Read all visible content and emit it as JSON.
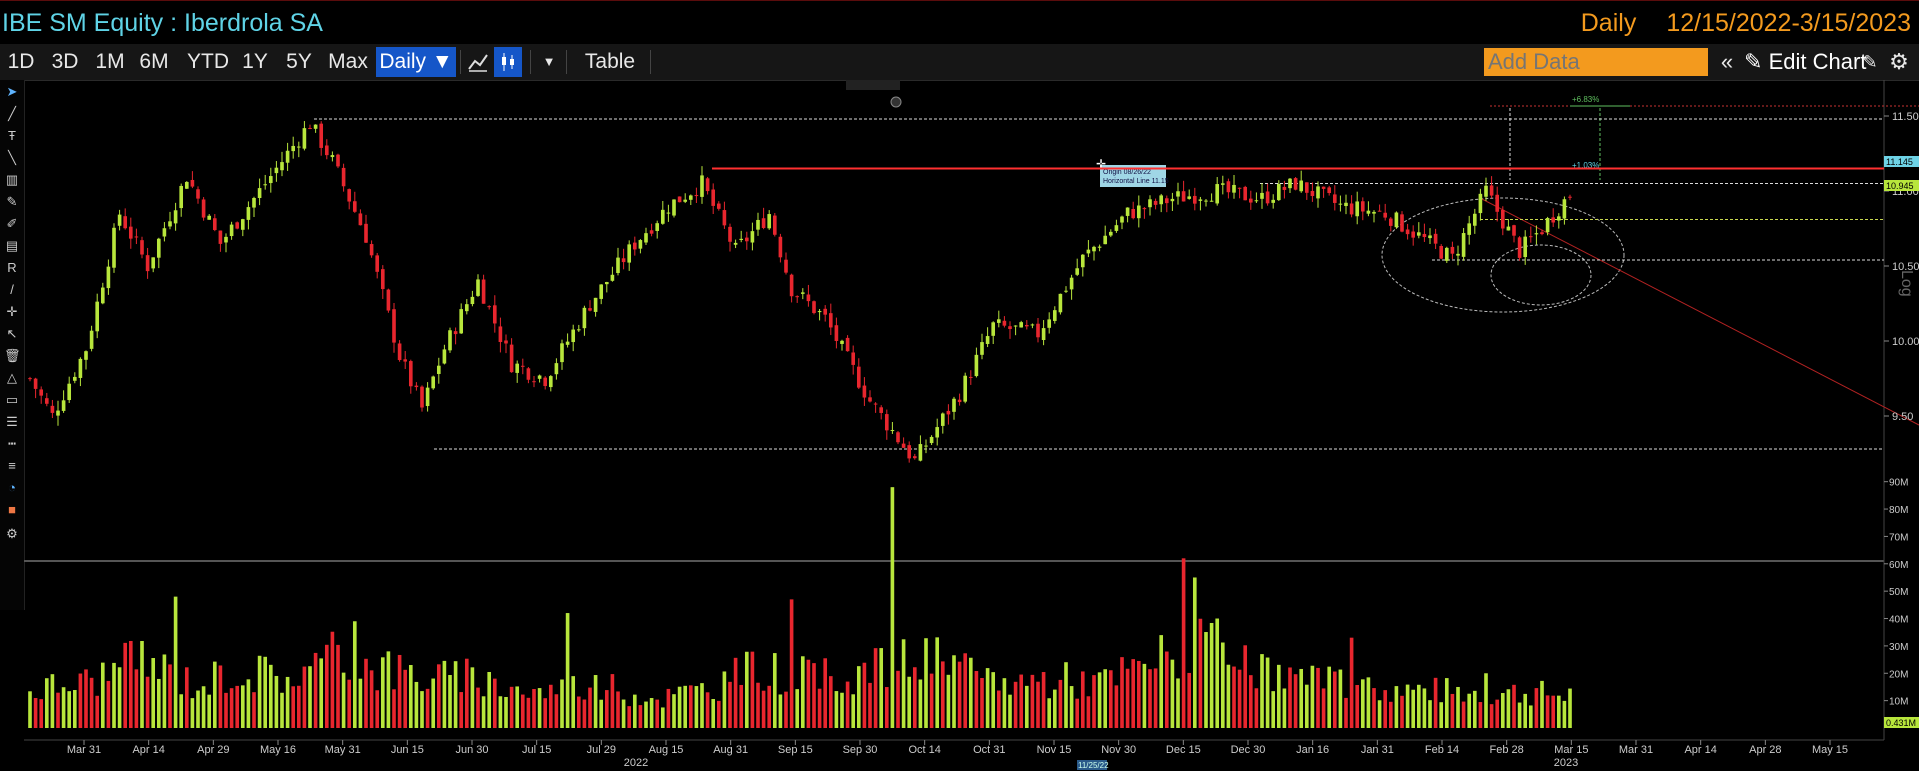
{
  "header": {
    "security_title": "IBE SM Equity : Iberdrola SA",
    "period_label": "Daily",
    "date_range": "12/15/2022-3/15/2023"
  },
  "toolbar": {
    "ranges": [
      "1D",
      "3D",
      "1M",
      "6M",
      "YTD",
      "1Y",
      "5Y",
      "Max"
    ],
    "frequency_label": "Daily ▼",
    "table_label": "Table",
    "add_data_placeholder": "Add Data",
    "edit_chart_label": "Edit Chart",
    "icons": [
      "line-chart-icon",
      "candlestick-icon",
      "dropdown-arrow-icon",
      "double-chevron-left-icon",
      "pencil-icon",
      "edit-settings-icon",
      "gear-icon"
    ]
  },
  "sidebar": {
    "icons": [
      "cursor-icon",
      "draw-line-icon",
      "text-tool-icon",
      "measure-icon",
      "fib-icon",
      "pencil-icon",
      "brush-icon",
      "ruler-icon",
      "r-icon",
      "line-tool-icon",
      "crosshair-icon",
      "arrow-icon",
      "trash-icon",
      "marker-icon",
      "rectangle-icon",
      "list-icon",
      "dashed-line-icon",
      "stack-icon",
      "magnet-icon",
      "color-palette-icon",
      "settings-icon"
    ]
  },
  "chart_data": {
    "type": "candlestick",
    "price_axis": {
      "ticks": [
        "11.50",
        "11.00",
        "10.50",
        "10.00",
        "9.50"
      ],
      "min": 9.2,
      "max": 11.8,
      "badges": [
        "11.145",
        "10.945"
      ]
    },
    "side_label": "Log",
    "volume_axis": {
      "ticks": [
        "90M",
        "80M",
        "70M",
        "60M",
        "50M",
        "40M",
        "30M",
        "20M",
        "10M"
      ],
      "badge": "0.431M",
      "max": 95
    },
    "x_ticks": [
      "Mar 31",
      "Apr 14",
      "Apr 29",
      "May 16",
      "May 31",
      "Jun 15",
      "Jun 30",
      "Jul 15",
      "Jul 29",
      "Aug 15",
      "Aug 31",
      "Sep 15",
      "Sep 30",
      "Oct 14",
      "Oct 31",
      "Nov 15",
      "Nov 30",
      "Dec 15",
      "Dec 30",
      "Jan 16",
      "Jan 31",
      "Feb 14",
      "Feb 28",
      "Mar 15",
      "Mar 31",
      "Apr 14",
      "Apr 28",
      "May 15"
    ],
    "year_labels": [
      "2022",
      "2023"
    ],
    "cursor_date": "11/25/22",
    "annotation": {
      "line1": "Origin 08/26/22",
      "line2": "Horizontal Line 11.15",
      "pct_top": "+6.83%",
      "pct_mid": "+1.03%"
    },
    "horizontal_lines": [
      11.48,
      11.15,
      11.05,
      10.81,
      10.54,
      9.28
    ],
    "close_anchors": [
      [
        0,
        9.75
      ],
      [
        4,
        9.5
      ],
      [
        10,
        9.95
      ],
      [
        16,
        10.85
      ],
      [
        21,
        10.5
      ],
      [
        28,
        11.1
      ],
      [
        34,
        10.65
      ],
      [
        39,
        10.9
      ],
      [
        46,
        11.25
      ],
      [
        50,
        11.45
      ],
      [
        54,
        11.2
      ],
      [
        60,
        10.7
      ],
      [
        66,
        9.9
      ],
      [
        70,
        9.55
      ],
      [
        74,
        9.95
      ],
      [
        80,
        10.4
      ],
      [
        86,
        9.85
      ],
      [
        92,
        9.75
      ],
      [
        100,
        10.25
      ],
      [
        108,
        10.65
      ],
      [
        114,
        10.9
      ],
      [
        120,
        11.05
      ],
      [
        126,
        10.6
      ],
      [
        132,
        10.85
      ],
      [
        136,
        10.35
      ],
      [
        142,
        10.15
      ],
      [
        150,
        9.6
      ],
      [
        158,
        9.2
      ],
      [
        166,
        9.65
      ],
      [
        172,
        10.1
      ],
      [
        180,
        10.05
      ],
      [
        188,
        10.55
      ],
      [
        196,
        10.85
      ],
      [
        204,
        10.95
      ],
      [
        212,
        11.0
      ],
      [
        220,
        10.95
      ],
      [
        226,
        11.05
      ],
      [
        234,
        10.9
      ],
      [
        242,
        10.85
      ],
      [
        248,
        10.7
      ],
      [
        254,
        10.55
      ],
      [
        260,
        11.0
      ],
      [
        266,
        10.6
      ],
      [
        270,
        10.75
      ],
      [
        275,
        10.98
      ]
    ],
    "volume_anchors": [
      [
        0,
        14
      ],
      [
        10,
        17
      ],
      [
        20,
        25
      ],
      [
        30,
        16
      ],
      [
        36,
        21
      ],
      [
        48,
        19
      ],
      [
        55,
        27
      ],
      [
        62,
        22
      ],
      [
        70,
        19
      ],
      [
        80,
        18
      ],
      [
        90,
        13
      ],
      [
        100,
        16
      ],
      [
        112,
        11
      ],
      [
        120,
        14
      ],
      [
        130,
        22
      ],
      [
        140,
        18
      ],
      [
        152,
        22
      ],
      [
        160,
        26
      ],
      [
        168,
        19
      ],
      [
        176,
        17
      ],
      [
        184,
        18
      ],
      [
        192,
        17
      ],
      [
        200,
        24
      ],
      [
        208,
        31
      ],
      [
        216,
        22
      ],
      [
        226,
        18
      ],
      [
        236,
        15
      ],
      [
        246,
        14
      ],
      [
        256,
        13
      ],
      [
        266,
        13
      ],
      [
        275,
        12
      ]
    ],
    "volume_spikes": [
      [
        26,
        48
      ],
      [
        58,
        39
      ],
      [
        64,
        28
      ],
      [
        96,
        42
      ],
      [
        136,
        47
      ],
      [
        154,
        88
      ],
      [
        206,
        62
      ],
      [
        208,
        55
      ],
      [
        212,
        40
      ],
      [
        220,
        27
      ],
      [
        236,
        33
      ],
      [
        260,
        20
      ]
    ]
  }
}
